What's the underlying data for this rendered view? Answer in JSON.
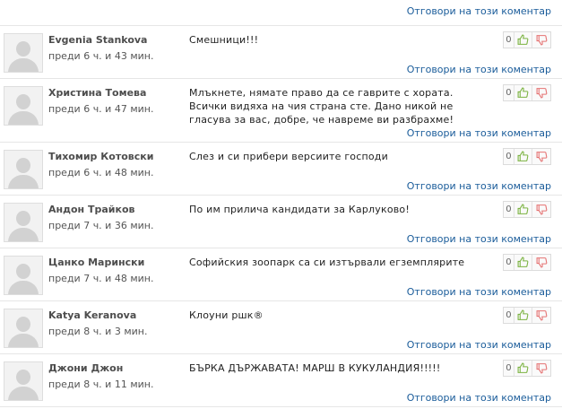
{
  "reply_label": "Отговори на този коментар",
  "comments": [
    {
      "author": "Evgenia Stankova",
      "time": "преди 6 ч. и 43 мин.",
      "text": "Смешници!!!",
      "votes": "0"
    },
    {
      "author": "Христина Томева",
      "time": "преди 6 ч. и 47 мин.",
      "text": "Млъкнете, нямате право да се гаврите с хората. Всички видяха на чия страна сте. Дано никой не гласува за вас, добре, че навреме ви разбрахме!",
      "votes": "0"
    },
    {
      "author": "Тихомир Котовски",
      "time": "преди 6 ч. и 48 мин.",
      "text": "Слез и си прибери версиите господи",
      "votes": "0"
    },
    {
      "author": "Андон Трайков",
      "time": "преди 7 ч. и 36 мин.",
      "text": "По им прилича кандидати за Карлуково!",
      "votes": "0"
    },
    {
      "author": "Цанко Марински",
      "time": "преди 7 ч. и 48 мин.",
      "text": "Софийския зоопарк са си изтървали егземплярите",
      "votes": "0"
    },
    {
      "author": "Katya Keranova",
      "time": "преди 8 ч. и 3 мин.",
      "text": "Клоуни ршк®",
      "votes": "0"
    },
    {
      "author": "Джони Джон",
      "time": "преди 8 ч. и 11 мин.",
      "text": "БЪРКА ДЪРЖАВАТА! МАРШ В КУКУЛАНДИЯ!!!!!",
      "votes": "0"
    }
  ],
  "colors": {
    "link": "#1a5c9a",
    "thumbs_up": "#7cb342",
    "thumbs_down": "#e57373"
  }
}
